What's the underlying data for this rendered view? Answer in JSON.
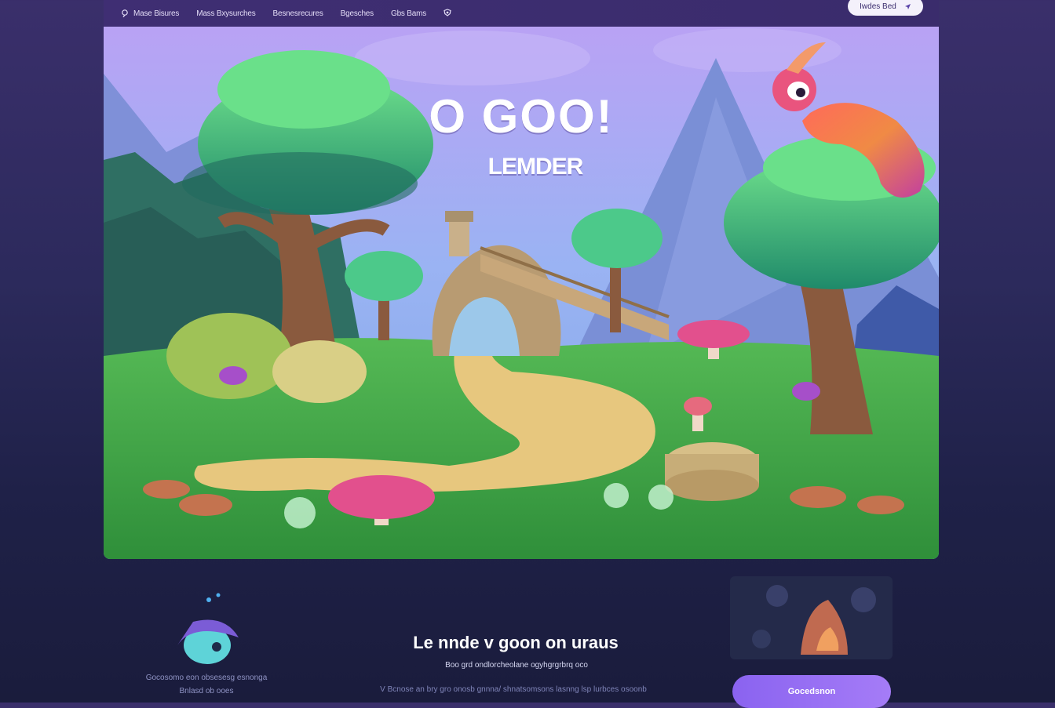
{
  "nav": {
    "items": [
      "Mase Bisures",
      "Mass Bxysurches",
      "Besnesrecures",
      "Bgesches",
      "Gbs Bams"
    ],
    "select_label": "Iwdes Bed"
  },
  "hero": {
    "logo": "O GOO!",
    "subtitle": "LEMDER"
  },
  "section": {
    "title": "Le nnde v goon on uraus",
    "subtitle": "Boo grd ondlorcheolane ogyhgrgrbrq oco",
    "footer": "V Bcnose an bry gro onosb gnnna/ shnatsomsons lasnng lsp lurbces osoonb"
  },
  "left_caption": {
    "line1": "Gocosomo eon obsesesg esnonga",
    "line2": "Bnlasd ob ooes"
  },
  "cta": {
    "label": "Gocedsnon"
  },
  "colors": {
    "accent": "#9a70f4",
    "nav_bg": "#3d2e71",
    "page_bg": "#1f2148"
  }
}
